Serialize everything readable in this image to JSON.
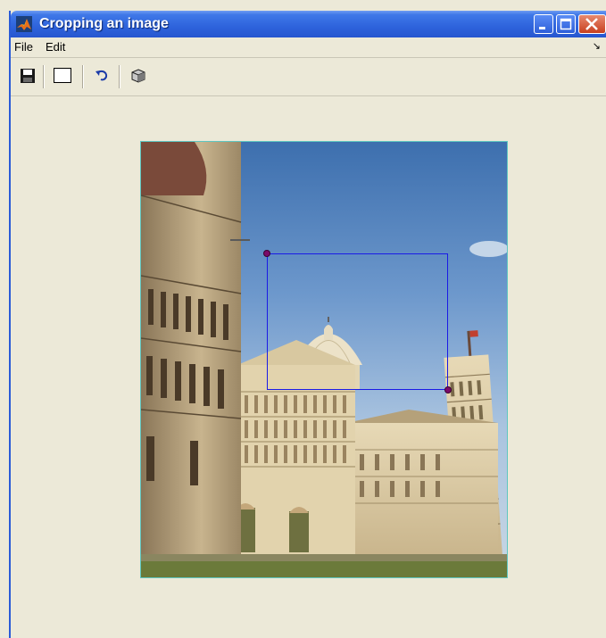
{
  "window": {
    "title": "Cropping an image",
    "title_icon": "matlab-logo-icon"
  },
  "menubar": {
    "items": [
      {
        "label": "File"
      },
      {
        "label": "Edit"
      }
    ],
    "overflow_icon": "menu-dock-arrow-icon"
  },
  "toolbar": {
    "tools": [
      {
        "icon": "save-icon"
      },
      {
        "icon": "rectangle-select-icon"
      },
      {
        "icon": "undo-icon"
      },
      {
        "icon": "3d-box-icon"
      }
    ]
  },
  "image": {
    "subject": "Piazza dei Miracoli, Pisa"
  },
  "colors": {
    "titlebar": "#2e63dc",
    "crop_rect": "#1a1ae6",
    "handle": "#7a0a6a",
    "image_border": "#5fc6c0",
    "background": "#ece9d8"
  }
}
